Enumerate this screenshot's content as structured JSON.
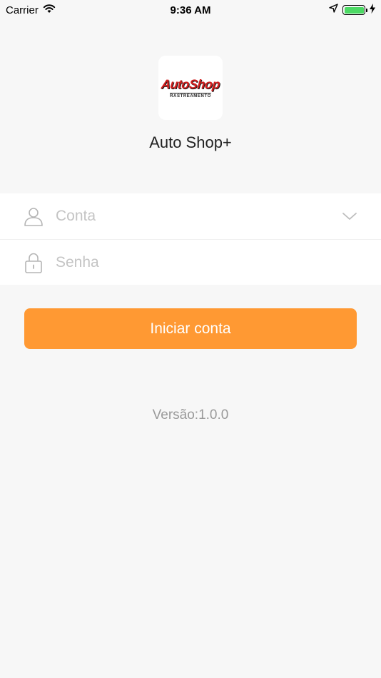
{
  "status_bar": {
    "carrier": "Carrier",
    "time": "9:36 AM",
    "battery_level": 1.0
  },
  "logo": {
    "brand": "AutoShop",
    "tagline": "RASTREAMENTO"
  },
  "app": {
    "title": "Auto Shop+"
  },
  "form": {
    "account_placeholder": "Conta",
    "account_value": "",
    "password_placeholder": "Senha",
    "password_value": ""
  },
  "actions": {
    "login_label": "Iniciar conta"
  },
  "footer": {
    "version": "Versão:1.0.0"
  },
  "colors": {
    "accent": "#ff9933",
    "background": "#f7f7f7",
    "battery": "#4cd964",
    "logo_red": "#d21e1e"
  }
}
